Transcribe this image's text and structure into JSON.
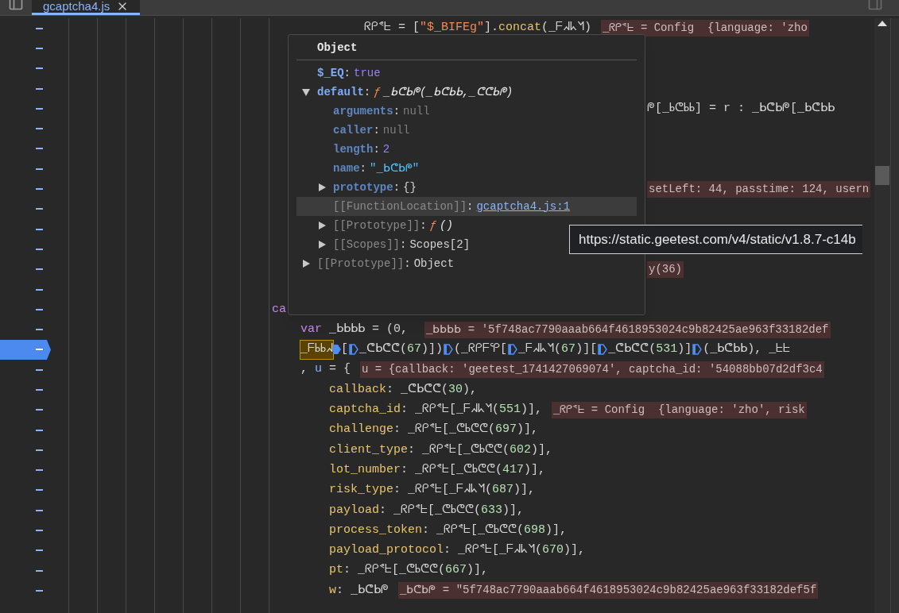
{
  "tabs": [
    {
      "label": "gcaptcha4.js",
      "selected": true
    }
  ],
  "code_lines": [
    {
      "kind": "nested",
      "current": false,
      "segments": [
        {
          "kind": "plain",
          "text": "ᖇᑭᕝᖶ = ["
        },
        {
          "kind": "string",
          "text": "\"$_BIFEg\""
        },
        {
          "kind": "plain",
          "text": "]."
        },
        {
          "kind": "method",
          "text": "concat"
        },
        {
          "kind": "plain",
          "text": "(_ᖴᖽᖾᖿ)"
        },
        {
          "kind": "inline",
          "text": "_ᖇᑭᕝᖶ = Config  {language: 'zho"
        }
      ]
    },
    {
      "kind": "blank",
      "current": false
    },
    {
      "kind": "blank",
      "current": false
    },
    {
      "kind": "blank",
      "current": false
    },
    {
      "kind": "behind_popup",
      "current": false,
      "segments": [
        {
          "kind": "plain",
          "text": "ᖘ[_ᖯᕦᖯᖯ] = r : _ᖯᕦᖯᖘ[_ᖯᕦᖯᖯ"
        }
      ]
    },
    {
      "kind": "blank",
      "current": false
    },
    {
      "kind": "blank",
      "current": false
    },
    {
      "kind": "blank",
      "current": false
    },
    {
      "kind": "behind_popup",
      "current": false,
      "segments": [
        {
          "kind": "inline",
          "text": "setLeft: 44, passtime: 124, usern"
        }
      ]
    },
    {
      "kind": "blank",
      "current": false
    },
    {
      "kind": "blank",
      "current": false
    },
    {
      "kind": "blank",
      "current": false
    },
    {
      "kind": "behind_popup",
      "current": false,
      "segments": [
        {
          "kind": "inline",
          "text": "y(36)"
        }
      ]
    },
    {
      "kind": "blank",
      "current": false
    },
    {
      "kind": "case",
      "current": false,
      "segments": [
        {
          "kind": "keyword",
          "text": "ca"
        }
      ]
    },
    {
      "kind": "statement",
      "current": false,
      "segments": [
        {
          "kind": "keyword",
          "text": "var"
        },
        {
          "kind": "plain",
          "text": " _ᖯᖯᖯᖯ = (0, "
        },
        {
          "kind": "inline",
          "text": "_ᖯᖯᖯᖯ = '5f748ac7790aaab664f4618953024c9b82425ae963f33182def"
        }
      ]
    },
    {
      "kind": "statement",
      "current": true,
      "segments": [
        {
          "kind": "paused",
          "text": "_ᖴᖯᖯᖽ"
        },
        {
          "kind": "execution_marker"
        },
        {
          "kind": "plain",
          "text": "["
        },
        {
          "kind": "step_marker"
        },
        {
          "kind": "plain",
          "text": "_ᕦᖯᕦᕦ("
        },
        {
          "kind": "number",
          "text": "67"
        },
        {
          "kind": "plain",
          "text": ")])"
        },
        {
          "kind": "step_marker"
        },
        {
          "kind": "plain",
          "text": "(_ᖇᑭᖴᕿ["
        },
        {
          "kind": "step_marker"
        },
        {
          "kind": "plain",
          "text": "_ᖴᖽᖾᖿ("
        },
        {
          "kind": "number",
          "text": "67"
        },
        {
          "kind": "plain",
          "text": ")]["
        },
        {
          "kind": "step_marker"
        },
        {
          "kind": "plain",
          "text": "_ᕦᖯᕦᕦ("
        },
        {
          "kind": "number",
          "text": "531"
        },
        {
          "kind": "plain",
          "text": ")]"
        },
        {
          "kind": "step_marker"
        },
        {
          "kind": "plain",
          "text": "(_ᖯᕦᖯᖯ), _ᖶᖶ"
        }
      ]
    },
    {
      "kind": "statement",
      "current": false,
      "segments": [
        {
          "kind": "plain",
          "text": ", "
        },
        {
          "kind": "variable",
          "text": "u"
        },
        {
          "kind": "plain",
          "text": " = {"
        },
        {
          "kind": "inline",
          "text": "u = {callback: 'geetest_1741427069074', captcha_id: '54088bb07d2df3c4"
        }
      ]
    },
    {
      "kind": "property",
      "current": false,
      "segments": [
        {
          "kind": "prop",
          "text": "callback"
        },
        {
          "kind": "plain",
          "text": ": _ᕦᖯᕦᕦ("
        },
        {
          "kind": "number",
          "text": "30"
        },
        {
          "kind": "plain",
          "text": "),"
        }
      ]
    },
    {
      "kind": "property",
      "current": false,
      "segments": [
        {
          "kind": "prop",
          "text": "captcha_id"
        },
        {
          "kind": "plain",
          "text": ": _ᖇᑭᕝᖶ[_ᖴᖽᖾᖿ("
        },
        {
          "kind": "number",
          "text": "551"
        },
        {
          "kind": "plain",
          "text": ")],"
        },
        {
          "kind": "inline",
          "text": "_ᖇᑭᕝᖶ = Config  {language: 'zho', risk"
        }
      ]
    },
    {
      "kind": "property",
      "current": false,
      "segments": [
        {
          "kind": "prop",
          "text": "challenge"
        },
        {
          "kind": "plain",
          "text": ": _ᖇᑭᕝᖶ[_ᕦᖯᕦᕦ("
        },
        {
          "kind": "number",
          "text": "697"
        },
        {
          "kind": "plain",
          "text": ")],"
        }
      ]
    },
    {
      "kind": "property",
      "current": false,
      "segments": [
        {
          "kind": "prop",
          "text": "client_type"
        },
        {
          "kind": "plain",
          "text": ": _ᖇᑭᕝᖶ[_ᕦᖯᕦᕦ("
        },
        {
          "kind": "number",
          "text": "602"
        },
        {
          "kind": "plain",
          "text": ")],"
        }
      ]
    },
    {
      "kind": "property",
      "current": false,
      "segments": [
        {
          "kind": "prop",
          "text": "lot_number"
        },
        {
          "kind": "plain",
          "text": ": _ᖇᑭᕝᖶ[_ᕦᖯᕦᕦ("
        },
        {
          "kind": "number",
          "text": "417"
        },
        {
          "kind": "plain",
          "text": ")],"
        }
      ]
    },
    {
      "kind": "property",
      "current": false,
      "segments": [
        {
          "kind": "prop",
          "text": "risk_type"
        },
        {
          "kind": "plain",
          "text": ": _ᖇᑭᕝᖶ[_ᖴᖽᖾᖿ("
        },
        {
          "kind": "number",
          "text": "687"
        },
        {
          "kind": "plain",
          "text": ")],"
        }
      ]
    },
    {
      "kind": "property",
      "current": false,
      "segments": [
        {
          "kind": "prop",
          "text": "payload"
        },
        {
          "kind": "plain",
          "text": ": _ᖇᑭᕝᖶ[_ᕦᖯᕦᕦ("
        },
        {
          "kind": "number",
          "text": "633"
        },
        {
          "kind": "plain",
          "text": ")],"
        }
      ]
    },
    {
      "kind": "property",
      "current": false,
      "segments": [
        {
          "kind": "prop",
          "text": "process_token"
        },
        {
          "kind": "plain",
          "text": ": _ᖇᑭᕝᖶ[_ᕦᖯᕦᕦ("
        },
        {
          "kind": "number",
          "text": "698"
        },
        {
          "kind": "plain",
          "text": ")],"
        }
      ]
    },
    {
      "kind": "property",
      "current": false,
      "segments": [
        {
          "kind": "prop",
          "text": "payload_protocol"
        },
        {
          "kind": "plain",
          "text": ": _ᖇᑭᕝᖶ[_ᖴᖽᖾᖿ("
        },
        {
          "kind": "number",
          "text": "670"
        },
        {
          "kind": "plain",
          "text": ")],"
        }
      ]
    },
    {
      "kind": "property",
      "current": false,
      "segments": [
        {
          "kind": "prop",
          "text": "pt"
        },
        {
          "kind": "plain",
          "text": ": _ᖇᑭᕝᖶ[_ᕦᖯᕦᕦ("
        },
        {
          "kind": "number",
          "text": "667"
        },
        {
          "kind": "plain",
          "text": ")],"
        }
      ]
    },
    {
      "kind": "property",
      "current": false,
      "segments": [
        {
          "kind": "prop",
          "text": "w"
        },
        {
          "kind": "plain",
          "text": ": _ᖯᕦᖯᖘ"
        },
        {
          "kind": "inline",
          "text": "_ᖯᕦᖯᖘ = \"5f748ac7790aaab664f4618953024c9b82425ae963f33182def5f"
        }
      ]
    }
  ],
  "popup": {
    "title": "Object",
    "rows": [
      {
        "kind": "own",
        "key": "$_EQ",
        "colon": ":",
        "value": {
          "kind": "boolean",
          "text": "true"
        },
        "selected": false
      },
      {
        "kind": "own",
        "key": "default",
        "colon": ":",
        "value": {
          "kind": "function",
          "prefix": "ƒ",
          "text": "_ᖯᕦᖯᖘ(_ᖯᕦᖯᖯ,_ᕦᕦᖯᖘ)"
        },
        "expanded": true,
        "selected": false,
        "children": [
          {
            "kind": "inherited",
            "key": "arguments",
            "colon": ":",
            "value": {
              "kind": "null",
              "text": "null"
            },
            "selected": false
          },
          {
            "kind": "inherited",
            "key": "caller",
            "colon": ":",
            "value": {
              "kind": "null",
              "text": "null"
            },
            "selected": false
          },
          {
            "kind": "inherited",
            "key": "length",
            "colon": ":",
            "value": {
              "kind": "number",
              "text": "2"
            },
            "selected": false
          },
          {
            "kind": "inherited",
            "key": "name",
            "colon": ":",
            "value": {
              "kind": "string",
              "text": "\"_ᖯᕦᖯᖘ\""
            },
            "selected": false
          },
          {
            "kind": "inherited",
            "key": "prototype",
            "colon": ":",
            "value": {
              "kind": "object",
              "text": "{}"
            },
            "expanded": false,
            "selected": false
          },
          {
            "kind": "internal",
            "key": "[[FunctionLocation]]",
            "colon": ":",
            "value": {
              "kind": "link",
              "text": "gcaptcha4.js:1"
            },
            "selected": true
          },
          {
            "kind": "internal",
            "key": "[[Prototype]]",
            "colon": ":",
            "value": {
              "kind": "function",
              "prefix": "ƒ",
              "text": "()"
            },
            "expanded": false,
            "selected": false
          },
          {
            "kind": "internal",
            "key": "[[Scopes]]",
            "colon": ":",
            "value": {
              "kind": "object",
              "text": "Scopes[2]"
            },
            "expanded": false,
            "selected": false
          }
        ]
      },
      {
        "kind": "internal",
        "key": "[[Prototype]]",
        "colon": ":",
        "value": {
          "kind": "object",
          "text": "Object"
        },
        "expanded": false,
        "selected": false
      }
    ]
  },
  "tooltip": "https://static.geetest.com/v4/static/v1.8.7-c14b"
}
